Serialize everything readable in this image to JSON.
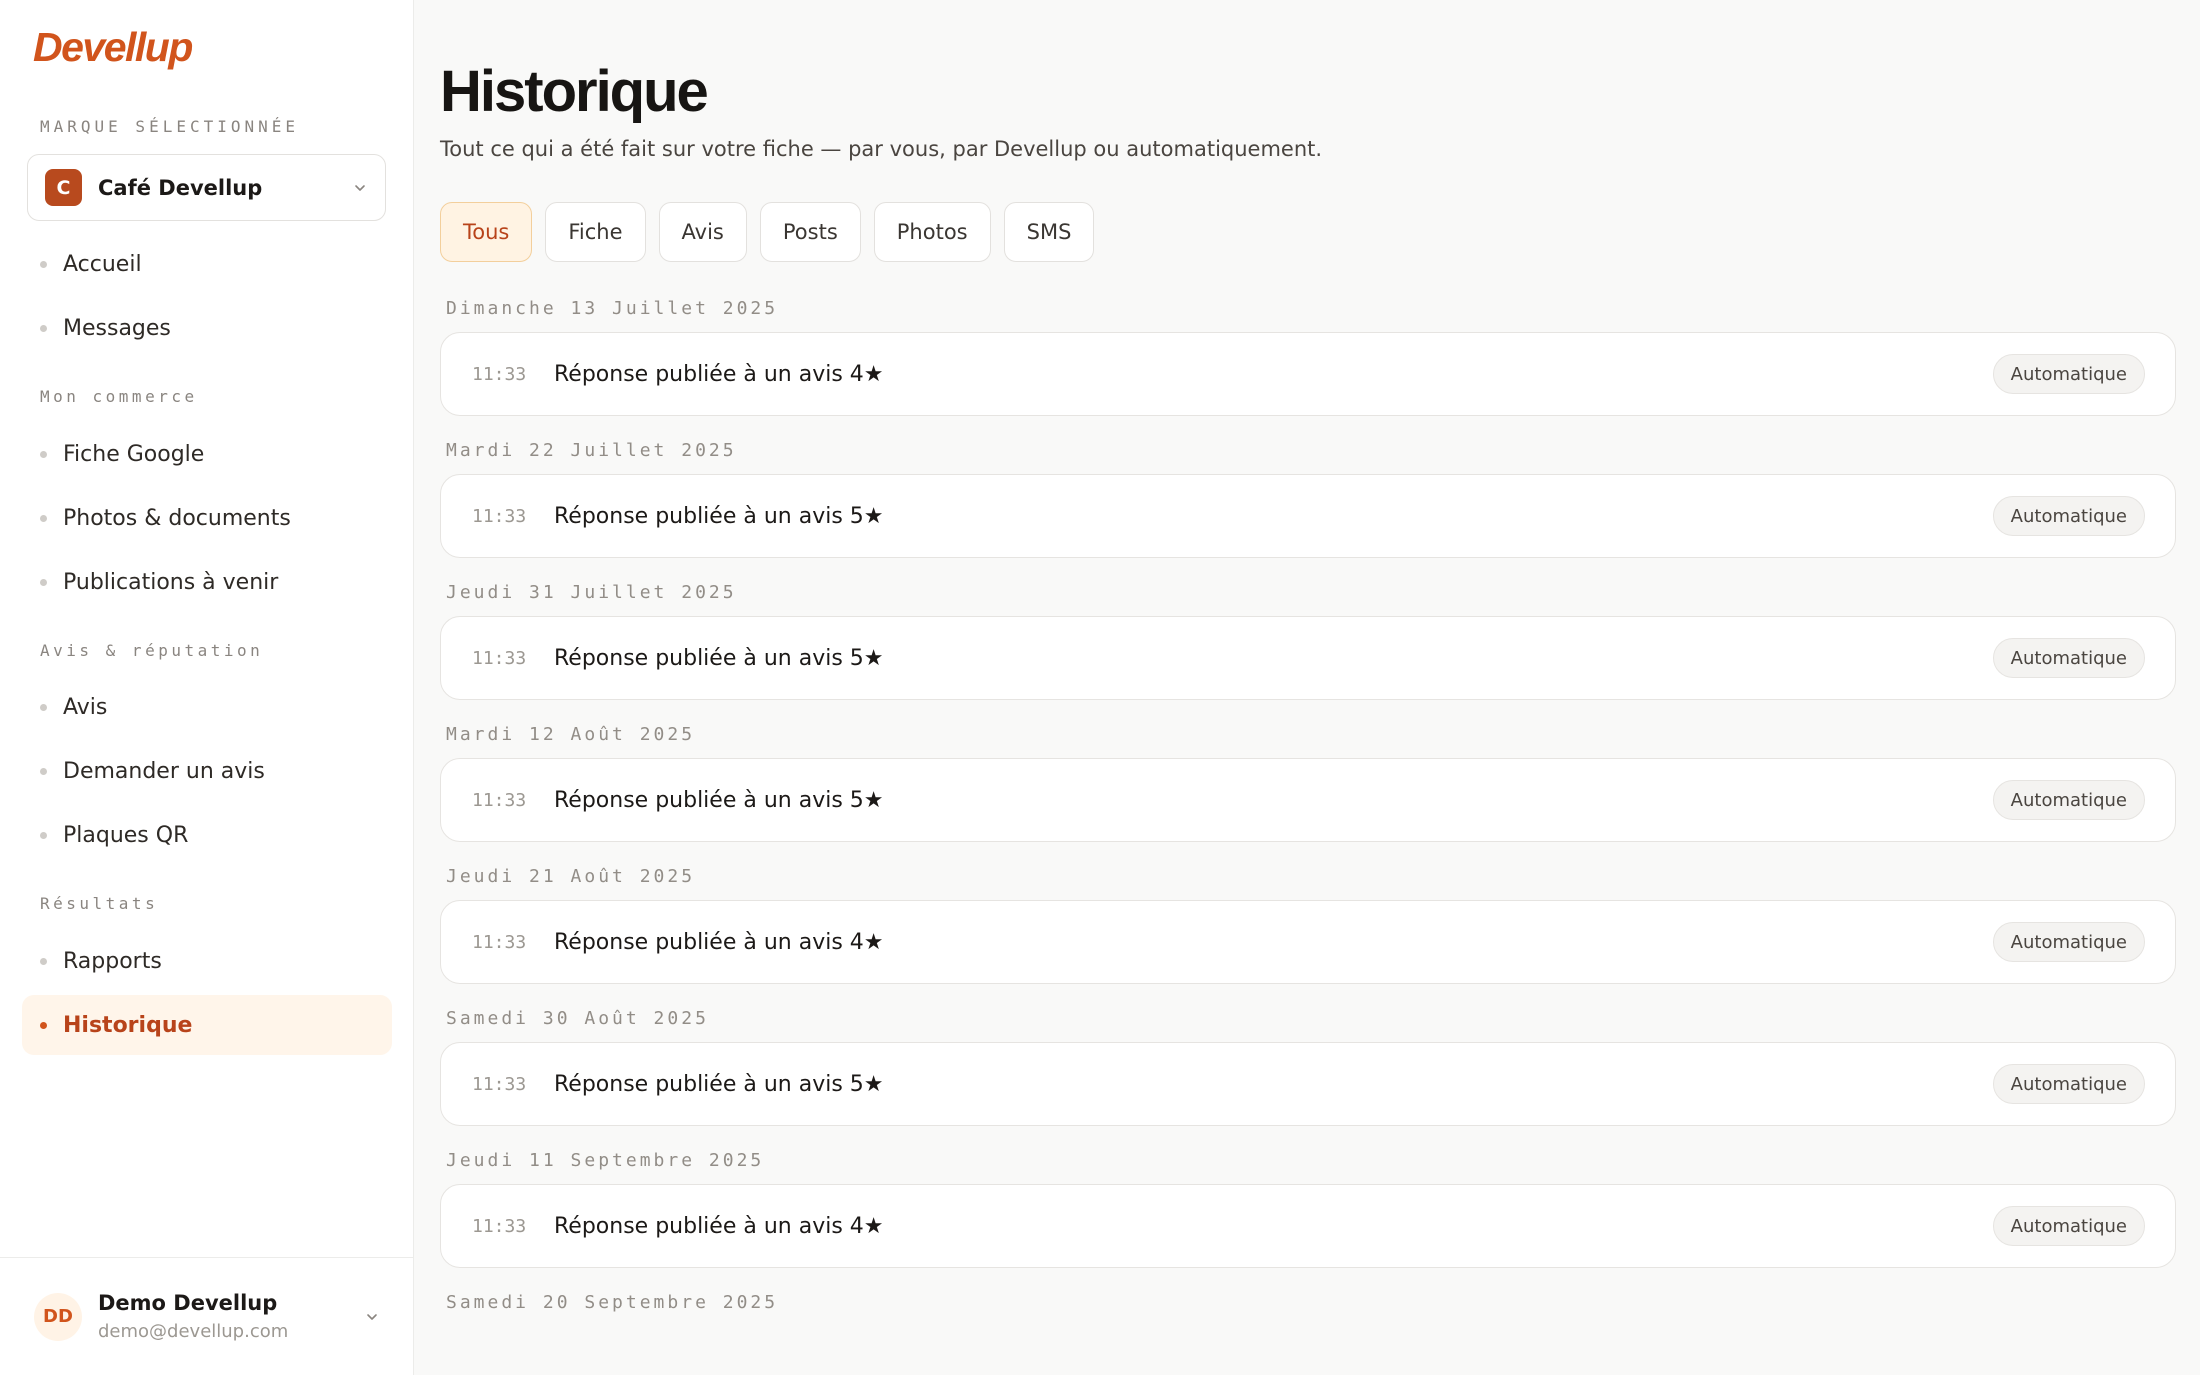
{
  "sidebar": {
    "logo": "Devellup",
    "brand_caption": "MARQUE SÉLECTIONNÉE",
    "brand": {
      "initial": "C",
      "name": "Café Devellup"
    },
    "nav_top": [
      {
        "label": "Accueil"
      },
      {
        "label": "Messages"
      }
    ],
    "sections": [
      {
        "title": "Mon commerce",
        "items": [
          {
            "label": "Fiche Google"
          },
          {
            "label": "Photos & documents"
          },
          {
            "label": "Publications à venir"
          }
        ]
      },
      {
        "title": "Avis & réputation",
        "items": [
          {
            "label": "Avis"
          },
          {
            "label": "Demander un avis"
          },
          {
            "label": "Plaques QR"
          }
        ]
      },
      {
        "title": "Résultats",
        "items": [
          {
            "label": "Rapports"
          },
          {
            "label": "Historique",
            "active": true
          }
        ]
      }
    ],
    "user": {
      "initials": "DD",
      "name": "Demo Devellup",
      "email": "demo@devellup.com"
    }
  },
  "main": {
    "title": "Historique",
    "subtitle": "Tout ce qui a été fait sur votre fiche — par vous, par Devellup ou automatiquement.",
    "filters": [
      "Tous",
      "Fiche",
      "Avis",
      "Posts",
      "Photos",
      "SMS"
    ],
    "active_filter": "Tous",
    "days": [
      {
        "label": "Dimanche 13 Juillet 2025",
        "events": [
          {
            "time": "11:33",
            "text": "Réponse publiée à un avis 4★",
            "badge": "Automatique"
          }
        ]
      },
      {
        "label": "Mardi 22 Juillet 2025",
        "events": [
          {
            "time": "11:33",
            "text": "Réponse publiée à un avis 5★",
            "badge": "Automatique"
          }
        ]
      },
      {
        "label": "Jeudi 31 Juillet 2025",
        "events": [
          {
            "time": "11:33",
            "text": "Réponse publiée à un avis 5★",
            "badge": "Automatique"
          }
        ]
      },
      {
        "label": "Mardi 12 Août 2025",
        "events": [
          {
            "time": "11:33",
            "text": "Réponse publiée à un avis 5★",
            "badge": "Automatique"
          }
        ]
      },
      {
        "label": "Jeudi 21 Août 2025",
        "events": [
          {
            "time": "11:33",
            "text": "Réponse publiée à un avis 4★",
            "badge": "Automatique"
          }
        ]
      },
      {
        "label": "Samedi 30 Août 2025",
        "events": [
          {
            "time": "11:33",
            "text": "Réponse publiée à un avis 5★",
            "badge": "Automatique"
          }
        ]
      },
      {
        "label": "Jeudi 11 Septembre 2025",
        "events": [
          {
            "time": "11:33",
            "text": "Réponse publiée à un avis 4★",
            "badge": "Automatique"
          }
        ]
      },
      {
        "label": "Samedi 20 Septembre 2025",
        "events": []
      }
    ]
  }
}
